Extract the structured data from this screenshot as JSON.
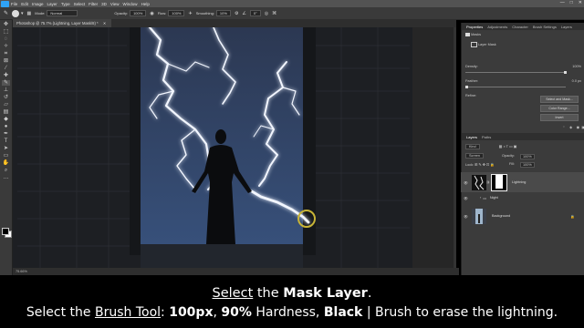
{
  "menu": {
    "items": [
      "File",
      "Edit",
      "Image",
      "Layer",
      "Type",
      "Select",
      "Filter",
      "3D",
      "View",
      "Window",
      "Help"
    ],
    "window_controls": [
      "—",
      "□",
      "✕"
    ]
  },
  "options": {
    "mode_label": "Mode:",
    "mode_value": "Normal",
    "opacity_label": "Opacity:",
    "opacity_value": "100%",
    "flow_label": "Flow:",
    "flow_value": "100%",
    "smoothing_label": "Smoothing:",
    "smoothing_value": "10%",
    "angle_value": "0°"
  },
  "document": {
    "tab_title": "Photoshop @ 75.7% (Lightning, Layer Mask/8) *",
    "status": "75.66%"
  },
  "properties": {
    "tabs": [
      "Properties",
      "Adjustments",
      "Character",
      "Brush Settings",
      "Layers"
    ],
    "section_label": "Masks",
    "mask_label": "Layer Mask",
    "density_label": "Density:",
    "density_value": "100%",
    "feather_label": "Feather:",
    "feather_value": "0.0 px",
    "refine_label": "Refine:",
    "select_mask_button": "Select and Mask...",
    "color_range_button": "Color Range...",
    "invert_button": "Invert"
  },
  "layers_panel": {
    "tabs": [
      "Layers",
      "Paths"
    ],
    "kind_label": "Kind",
    "blend_mode": "Screen",
    "opacity_label": "Opacity:",
    "opacity_value": "100%",
    "fill_label": "Fill:",
    "fill_value": "100%",
    "layers": [
      {
        "name": "Lightning"
      },
      {
        "name": "Night"
      },
      {
        "name": "Background"
      }
    ]
  },
  "caption": {
    "line1_a": "Select",
    "line1_b": " the ",
    "line1_c": "Mask Layer",
    "line1_d": ".",
    "line2_a": "Select the ",
    "line2_b": "Brush Tool",
    "line2_c": ": ",
    "line2_d": "100px",
    "line2_e": ", ",
    "line2_f": "90%",
    "line2_g": " Hardness, ",
    "line2_h": "Black",
    "line2_i": "  |  Brush to erase the lightning."
  }
}
